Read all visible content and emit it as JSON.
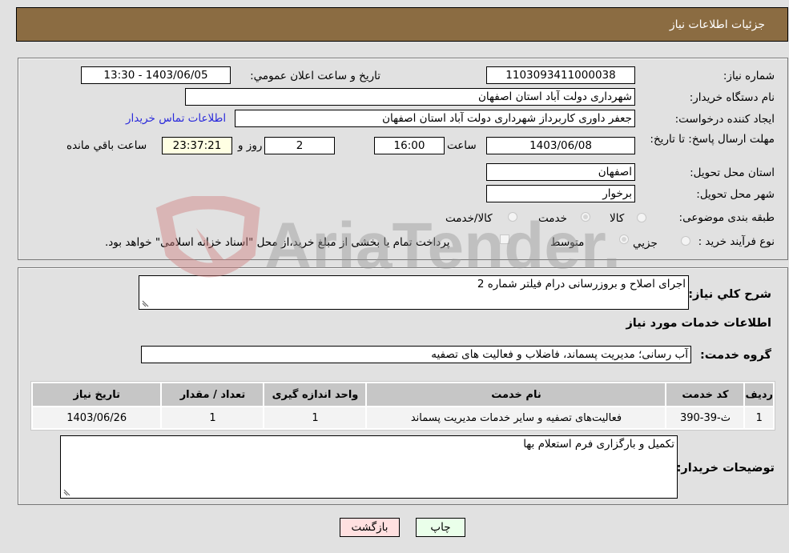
{
  "header": {
    "title": "جزئیات اطلاعات نیاز"
  },
  "form": {
    "need_number": {
      "label": "شماره نیاز:",
      "value": "1103093411000038"
    },
    "announce_datetime": {
      "label": "تاریخ و ساعت اعلان عمومي:",
      "value": "1403/06/05 - 13:30"
    },
    "buyer_org": {
      "label": "نام دستگاه خريدار:",
      "value": "شهرداری دولت آباد استان اصفهان"
    },
    "requester": {
      "label": "ايجاد كننده درخواست:",
      "value": "جعفر داوری کاربرداز شهرداری دولت آباد استان اصفهان"
    },
    "buyer_contact_link": "اطلاعات تماس خريدار",
    "deadline": {
      "label": "مهلت ارسال پاسخ: تا تاريخ:",
      "date": "1403/06/08",
      "time_label": "ساعت",
      "time": "16:00",
      "days": "2",
      "days_label": "روز و",
      "remaining": "23:37:21",
      "remaining_label": "ساعت باقي مانده"
    },
    "delivery_province": {
      "label": "استان محل تحويل:",
      "value": "اصفهان"
    },
    "delivery_city": {
      "label": "شهر محل تحويل:",
      "value": "برخوار"
    },
    "category": {
      "label": "طبقه بندی موضوعی:",
      "options": [
        "كالا",
        "خدمت",
        "كالا/خدمت"
      ],
      "selected": "خدمت"
    },
    "purchase_type": {
      "label": "نوع فرآیند خرید :",
      "options": [
        "جزیي",
        "متوسط"
      ],
      "selected": "متوسط",
      "treasury_note": "پرداخت تمام یا بخشی از مبلغ خرید،از محل \"اسناد خزانه اسلامی\" خواهد بود."
    }
  },
  "details": {
    "general_desc": {
      "label": "شرح کلي نياز:",
      "value": "اجرای اصلاح و بروزرسانی درام فیلتر شماره 2"
    },
    "services_title": "اطلاعات خدمات مورد نياز",
    "service_group": {
      "label": "گروه خدمت:",
      "value": "آب رسانی؛ مدیریت پسماند، فاضلاب و فعالیت های تصفیه"
    },
    "table": {
      "headers": [
        "رديف",
        "كد خدمت",
        "نام خدمت",
        "واحد اندازه گيری",
        "تعداد / مقدار",
        "تاريخ نياز"
      ],
      "rows": [
        [
          "1",
          "ث-39-390",
          "فعالیت‌های تصفیه و سایر خدمات مدیریت پسماند",
          "1",
          "1",
          "1403/06/26"
        ]
      ]
    },
    "buyer_notes": {
      "label": "توضيحات خريدار:",
      "value": "تکمیل و بارگزاری فرم استعلام بها"
    }
  },
  "buttons": {
    "print": "چاپ",
    "back": "بازگشت"
  },
  "watermark": {
    "text": "AriaTender.neT"
  },
  "colors": {
    "header_bg": "#8b6c42",
    "print_bg": "#eaffea",
    "back_bg": "#ffe0e0",
    "link": "#2a2adb"
  }
}
